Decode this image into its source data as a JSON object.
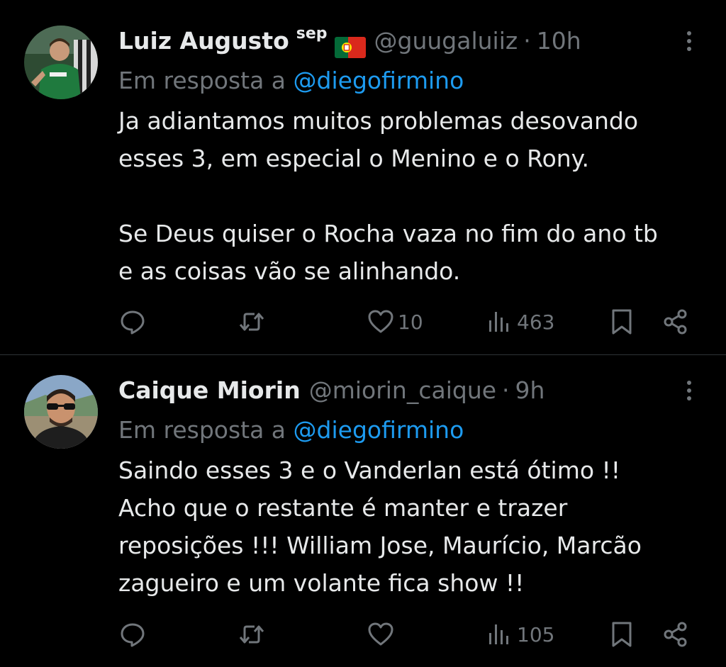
{
  "tweets": [
    {
      "display_name": "Luiz Augusto",
      "name_extra": "sep",
      "flag": "portugal-flag",
      "handle": "@guugaluiiz",
      "separator": "·",
      "time": "10h",
      "reply_prefix": "Em resposta a ",
      "reply_mention": "@diegofirmino",
      "body": "Ja adiantamos muitos problemas desovando\nesses 3, em especial o Menino e o Rony.\n\nSe Deus quiser o Rocha vaza no fim do ano tb\ne as coisas vão se alinhando.",
      "likes": "10",
      "views": "463",
      "avatar_colors": {
        "bg": "#3b5a3a",
        "shirt": "#1f7a3e",
        "skin": "#c89a7a"
      }
    },
    {
      "display_name": "Caique Miorin",
      "handle": "@miorin_caique",
      "separator": "·",
      "time": "9h",
      "reply_prefix": "Em resposta a ",
      "reply_mention": "@diegofirmino",
      "body": "Saindo esses 3 e o Vanderlan está ótimo !!\nAcho que o restante é manter e trazer\nreposições !!! William Jose, Maurício, Marcão\nzagueiro e um volante fica show !!",
      "likes": "",
      "views": "105",
      "avatar_colors": {
        "bg": "#8aa7c7",
        "shirt": "#2a2a2a",
        "skin": "#c9926e"
      }
    }
  ],
  "icons": {
    "reply": "reply-icon",
    "retweet": "retweet-icon",
    "like": "heart-icon",
    "views": "views-icon",
    "bookmark": "bookmark-icon",
    "share": "share-icon",
    "more": "more-icon"
  },
  "colors": {
    "background": "#000000",
    "text_primary": "#e7e9ea",
    "text_secondary": "#71767b",
    "link": "#1d9bf0",
    "divider": "#2f3336"
  }
}
